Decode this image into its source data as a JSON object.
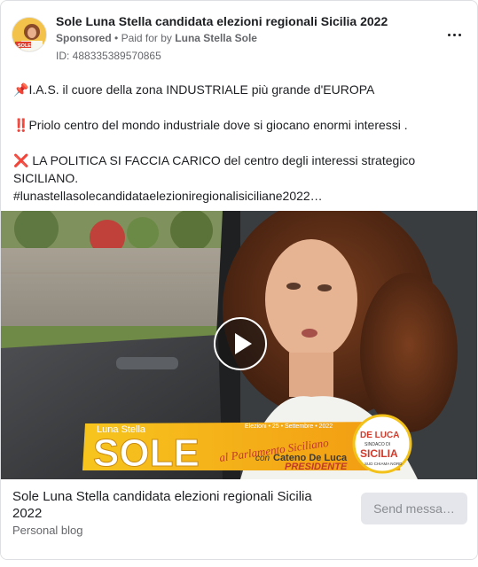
{
  "post": {
    "page_name": "Sole Luna Stella candidata elezioni regionali Sicilia 2022",
    "sponsored_label": "Sponsored",
    "separator": "•",
    "paid_for_label": "Paid for by",
    "paid_for_name": "Luna Stella Sole",
    "ad_id": "ID: 488335389570865",
    "more_icon": "more-horizontal-icon",
    "avatar_text": "SOLE"
  },
  "body": {
    "line1_emoji": "📌",
    "line1_text": "I.A.S. il cuore della zona INDUSTRIALE più grande d'EUROPA",
    "line2_emoji": "‼️",
    "line2_text": "Priolo centro del mondo industriale dove si giocano enormi interessi .",
    "line3_emoji": "❌",
    "line3_text": " LA POLITICA SI FACCIA CARICO del centro degli interessi strategico SICILIANO.",
    "line4_text": "#lunastellasolecandidataelezioniregionalisiciliane2022…"
  },
  "video": {
    "play_icon": "play-icon",
    "banner": {
      "luna_stella": "Luna Stella",
      "sole": "SOLE",
      "al_parlamento": "al Parlamento Siciliano",
      "elezioni": "Elezioni • 25 • Settembre • 2022",
      "con": "con",
      "cateno": "Cateno De Luca",
      "presidente": "PRESIDENTE",
      "logo_deluca": "DE LUCA",
      "logo_sindaco": "SINDACO DI",
      "logo_sicilia": "SICILIA",
      "logo_sud": "SUD CHIAMA NORD"
    }
  },
  "footer": {
    "title": "Sole Luna Stella candidata elezioni regionali Sicilia 2022",
    "subtitle": "Personal blog",
    "send_button": "Send messa…"
  },
  "colors": {
    "banner_yellow": "#f7c51e",
    "banner_orange": "#f29a12",
    "text_primary": "#1c1e21",
    "text_secondary": "#65676b",
    "button_bg": "#e4e6eb"
  }
}
